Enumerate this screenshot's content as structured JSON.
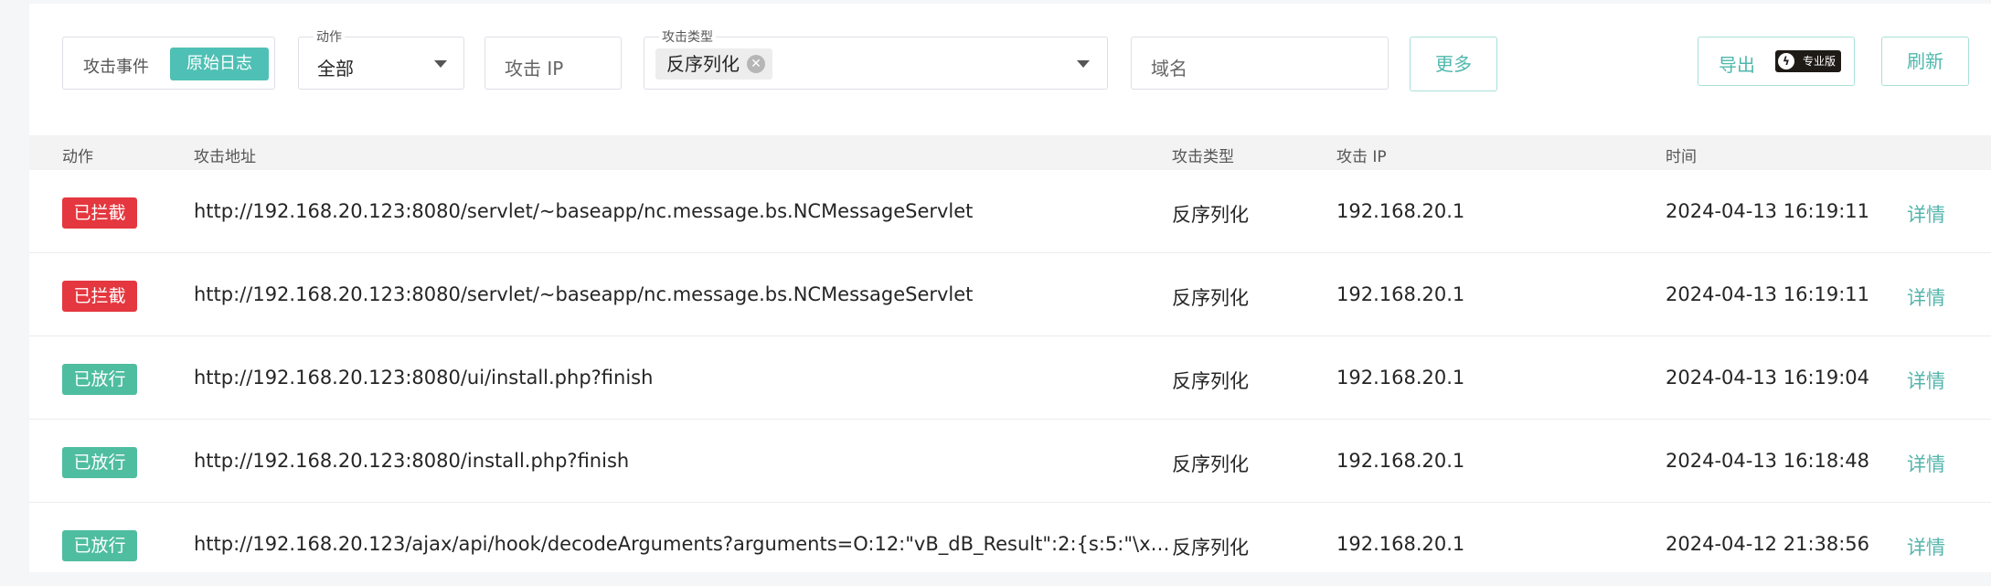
{
  "filters": {
    "segment": {
      "events_label": "攻击事件",
      "raw_logs_label": "原始日志"
    },
    "action": {
      "label": "动作",
      "value": "全部"
    },
    "ip": {
      "placeholder": "攻击 IP"
    },
    "attack_type": {
      "label": "攻击类型",
      "tag": "反序列化"
    },
    "domain": {
      "placeholder": "域名"
    },
    "more_label": "更多",
    "export_label": "导出",
    "pro_badge_label": "专业版",
    "refresh_label": "刷新"
  },
  "table": {
    "columns": {
      "action": "动作",
      "url": "攻击地址",
      "type": "攻击类型",
      "ip": "攻击 IP",
      "time": "时间"
    },
    "rows": [
      {
        "status": "已拦截",
        "status_kind": "blocked",
        "url": "http://192.168.20.123:8080/servlet/~baseapp/nc.message.bs.NCMessageServlet",
        "type": "反序列化",
        "ip": "192.168.20.1",
        "time": "2024-04-13 16:19:11",
        "detail": "详情"
      },
      {
        "status": "已拦截",
        "status_kind": "blocked",
        "url": "http://192.168.20.123:8080/servlet/~baseapp/nc.message.bs.NCMessageServlet",
        "type": "反序列化",
        "ip": "192.168.20.1",
        "time": "2024-04-13 16:19:11",
        "detail": "详情"
      },
      {
        "status": "已放行",
        "status_kind": "allowed",
        "url": "http://192.168.20.123:8080/ui/install.php?finish",
        "type": "反序列化",
        "ip": "192.168.20.1",
        "time": "2024-04-13 16:19:04",
        "detail": "详情"
      },
      {
        "status": "已放行",
        "status_kind": "allowed",
        "url": "http://192.168.20.123:8080/install.php?finish",
        "type": "反序列化",
        "ip": "192.168.20.1",
        "time": "2024-04-13 16:18:48",
        "detail": "详情"
      },
      {
        "status": "已放行",
        "status_kind": "allowed",
        "url": "http://192.168.20.123/ajax/api/hook/decodeArguments?arguments=O:12:\"vB_dB_Result\":2:{s:5:\"\\x0*\\x…",
        "type": "反序列化",
        "ip": "192.168.20.1",
        "time": "2024-04-12 21:38:56",
        "detail": "详情"
      }
    ]
  },
  "colors": {
    "accent": "#4fc0b5",
    "blocked": "#e4373f",
    "allowed": "#4fbda0",
    "link": "#55b5ac"
  }
}
